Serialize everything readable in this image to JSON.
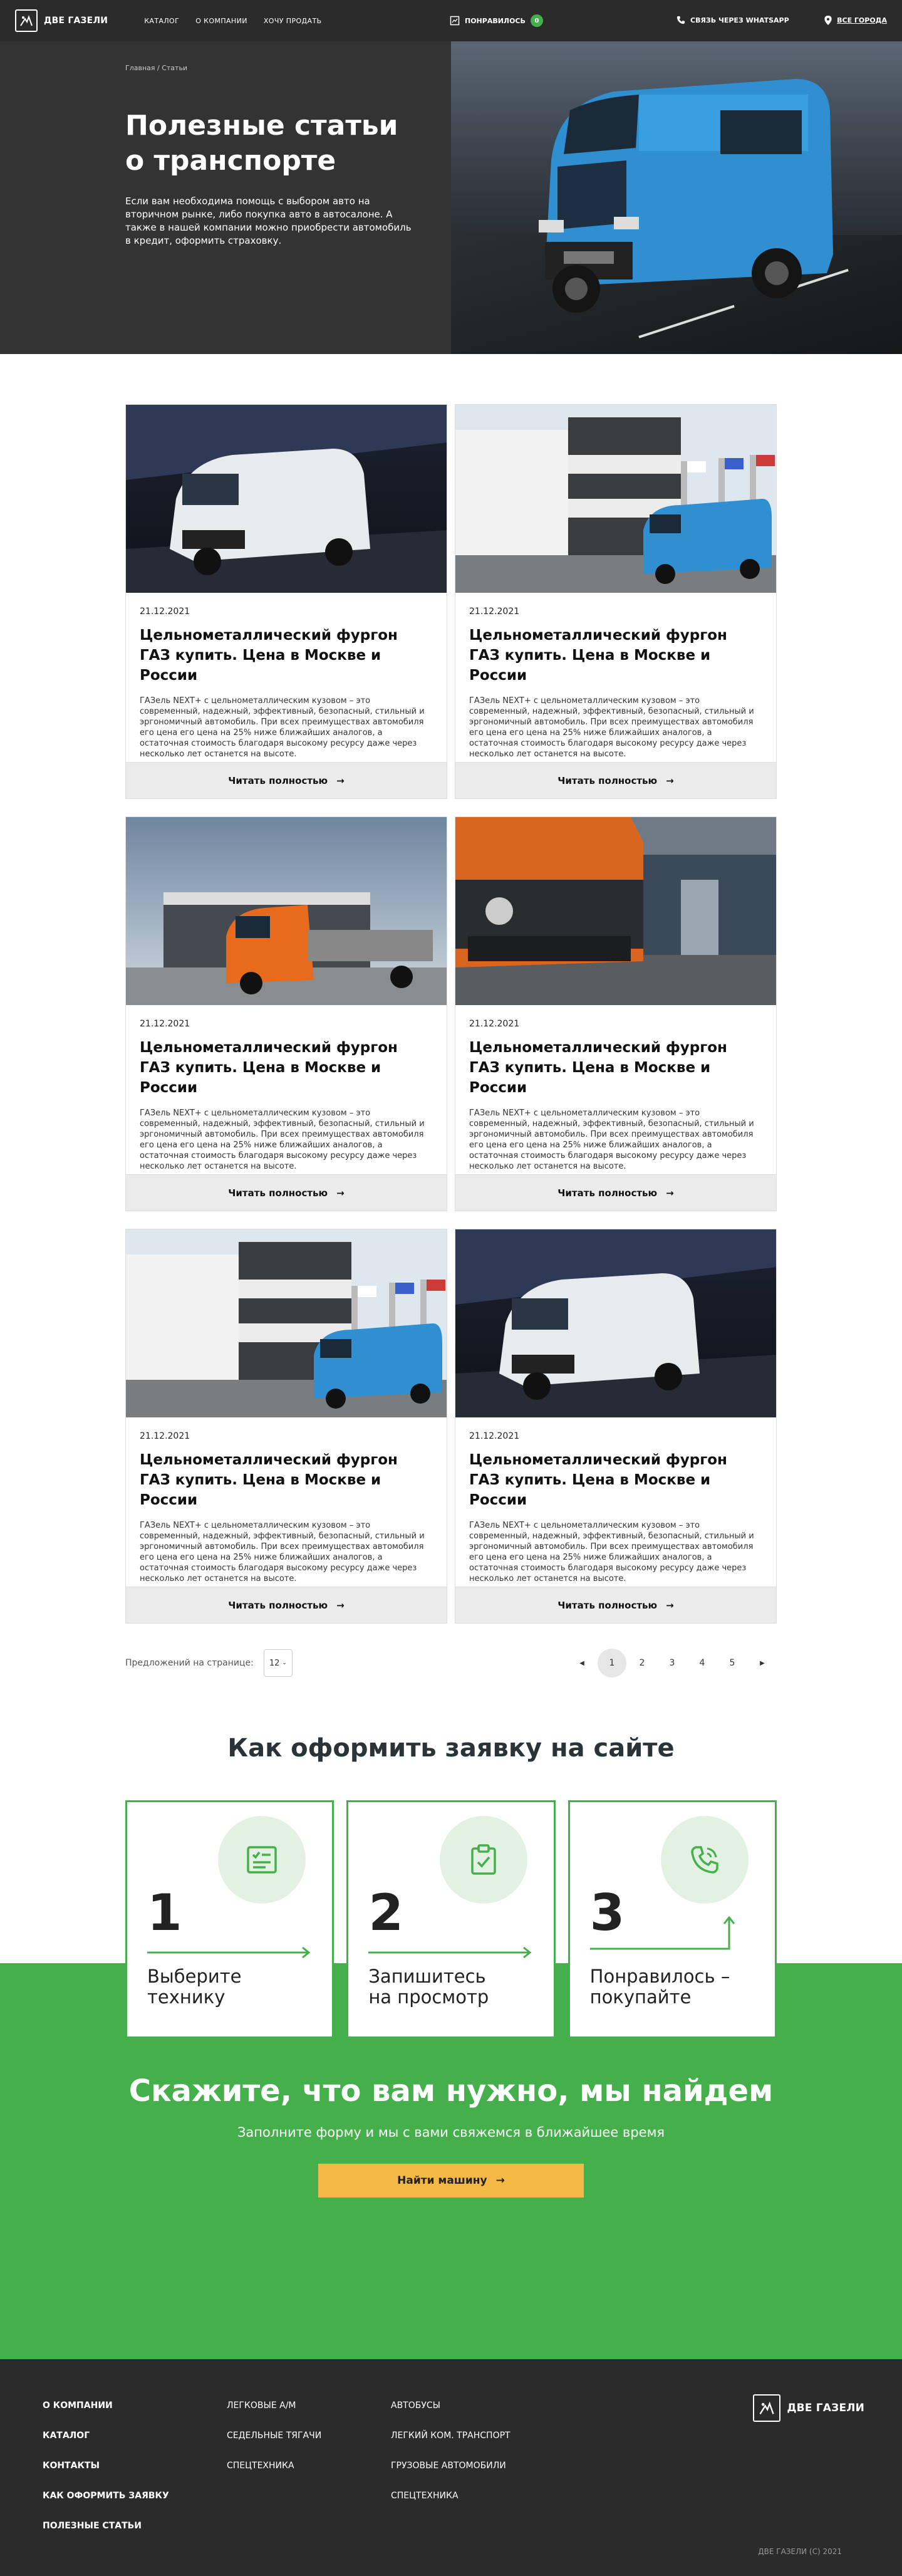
{
  "header": {
    "logo_text": "ДВЕ ГАЗЕЛИ",
    "nav": [
      "КАТАЛОГ",
      "О КОМПАНИИ",
      "ХОЧУ ПРОДАТЬ"
    ],
    "liked_label": "ПОНРАВИЛОСЬ",
    "liked_count": "0",
    "whatsapp_label": "СВЯЗЬ ЧЕРЕЗ WHATSAPP",
    "city_label": "ВСЕ ГОРОДА"
  },
  "hero": {
    "breadcrumb": "Главная / Статьи",
    "title_line1": "Полезные статьи",
    "title_line2": "о транспорте",
    "text": "Если вам необходима помощь с выбором авто на вторичном рынке, либо покупка авто в автосалоне. А также в нашей компании можно приобрести автомобиль в кредит, оформить страховку."
  },
  "articles": [
    {
      "date": "21.12.2021",
      "title": "Цельнометаллический фургон ГАЗ купить. Цена в Москве и России",
      "text": "ГАЗель NEXT+ с цельнометаллическим кузовом – это современный, надежный, эффективный, безопасный, стильный и эргономичный автомобиль. При всех преимуществах автомобиля его цена его цена на 25% ниже ближайших аналогов, а остаточная стоимость благодаря высокому ресурсу даже через несколько лет останется на высоте.",
      "button": "Читать полностью",
      "image": "white-van-tunnel"
    },
    {
      "date": "21.12.2021",
      "title": "Цельнометаллический фургон ГАЗ купить. Цена в Москве и России",
      "text": "ГАЗель NEXT+ с цельнометаллическим кузовом – это современный, надежный, эффективный, безопасный, стильный и эргономичный автомобиль. При всех преимуществах автомобиля его цена его цена на 25% ниже ближайших аналогов, а остаточная стоимость благодаря высокому ресурсу даже через несколько лет останется на высоте.",
      "button": "Читать полностью",
      "image": "blue-van-building"
    },
    {
      "date": "21.12.2021",
      "title": "Цельнометаллический фургон ГАЗ купить. Цена в Москве и России",
      "text": "ГАЗель NEXT+ с цельнометаллическим кузовом – это современный, надежный, эффективный, безопасный, стильный и эргономичный автомобиль. При всех преимуществах автомобиля его цена его цена на 25% ниже ближайших аналогов, а остаточная стоимость благодаря высокому ресурсу даже через несколько лет останется на высоте.",
      "button": "Читать полностью",
      "image": "orange-truck"
    },
    {
      "date": "21.12.2021",
      "title": "Цельнометаллический фургон ГАЗ купить. Цена в Москве и России",
      "text": "ГАЗель NEXT+ с цельнометаллическим кузовом – это современный, надежный, эффективный, безопасный, стильный и эргономичный автомобиль. При всех преимуществах автомобиля его цена его цена на 25% ниже ближайших аналогов, а остаточная стоимость благодаря высокому ресурсу даже через несколько лет останется на высоте.",
      "button": "Читать полностью",
      "image": "orange-van-closeup"
    },
    {
      "date": "21.12.2021",
      "title": "Цельнометаллический фургон ГАЗ купить. Цена в Москве и России",
      "text": "ГАЗель NEXT+ с цельнометаллическим кузовом – это современный, надежный, эффективный, безопасный, стильный и эргономичный автомобиль. При всех преимуществах автомобиля его цена его цена на 25% ниже ближайших аналогов, а остаточная стоимость благодаря высокому ресурсу даже через несколько лет останется на высоте.",
      "button": "Читать полностью",
      "image": "blue-van-building"
    },
    {
      "date": "21.12.2021",
      "title": "Цельнометаллический фургон ГАЗ купить. Цена в Москве и России",
      "text": "ГАЗель NEXT+ с цельнометаллическим кузовом – это современный, надежный, эффективный, безопасный, стильный и эргономичный автомобиль. При всех преимуществах автомобиля его цена его цена на 25% ниже ближайших аналогов, а остаточная стоимость благодаря высокому ресурсу даже через несколько лет останется на высоте.",
      "button": "Читать полностью",
      "image": "white-van-tunnel"
    }
  ],
  "pagination": {
    "per_page_label": "Предложений на странице:",
    "per_page_value": "12",
    "pages": [
      "1",
      "2",
      "3",
      "4",
      "5"
    ],
    "current": "1"
  },
  "how": {
    "title": "Как оформить заявку на сайте",
    "steps": [
      {
        "num": "1",
        "line1": "Выберите",
        "line2": "технику",
        "icon": "checklist-icon"
      },
      {
        "num": "2",
        "line1": "Запишитесь",
        "line2": "на просмотр",
        "icon": "clipboard-check-icon"
      },
      {
        "num": "3",
        "line1": "Понравилось –",
        "line2": "покупайте",
        "icon": "phone-call-icon"
      }
    ]
  },
  "cta": {
    "title": "Скажите, что вам нужно, мы найдем",
    "subtitle": "Заполните форму и мы с вами свяжемся  в ближайшее время",
    "button": "Найти машину"
  },
  "footer": {
    "col1": [
      "О КОМПАНИИ",
      "КАТАЛОГ",
      "КОНТАКТЫ",
      "КАК  ОФОРМИТЬ ЗАЯВКУ",
      "ПОЛЕЗНЫЕ СТАТЬИ"
    ],
    "col2": [
      "ЛЕГКОВЫЕ А/М",
      "СЕДЕЛЬНЫЕ ТЯГАЧИ",
      "СПЕЦТЕХНИКА"
    ],
    "col3": [
      "АВТОБУСЫ",
      "ЛЕГКИЙ КОМ. ТРАНСПОРТ",
      "ГРУЗОВЫЕ АВТОМОБИЛИ",
      "СПЕЦТЕХНИКА"
    ],
    "logo_text": "ДВЕ ГАЗЕЛИ",
    "copyright": "ДВЕ ГАЗЕЛИ (С) 2021"
  },
  "colors": {
    "accent_green": "#45b04b",
    "cta_yellow": "#f4b844",
    "dark": "#2b2b2b"
  }
}
